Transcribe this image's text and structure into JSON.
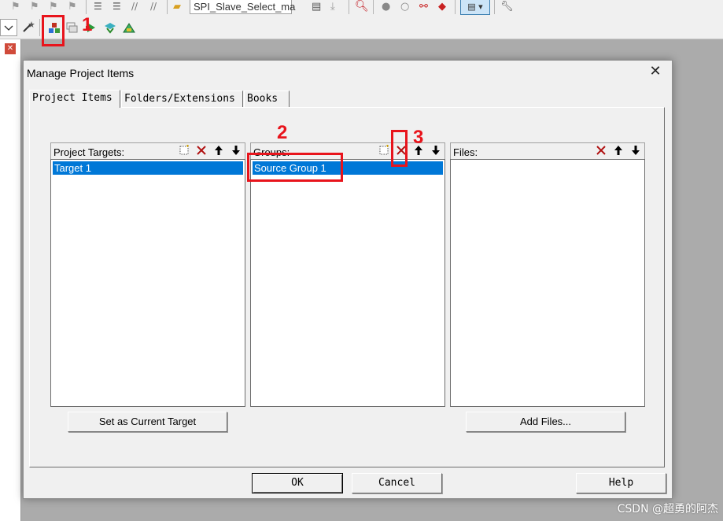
{
  "toolbar": {
    "target_select": "SPI_Slave_Select_ma",
    "icons": [
      "flag-icon",
      "flag-icon",
      "flag-icon",
      "flag-icon",
      "indent-icon",
      "outdent-icon",
      "comment-icon",
      "uncomment-icon",
      "open-folder-icon",
      "load-icon",
      "download-icon",
      "find-icon",
      "circle-icon",
      "circle-outline-icon",
      "link-icon",
      "fire-icon",
      "window-icon",
      "wrench-icon",
      "combo-arrow-icon",
      "magic-wand-icon",
      "manage-project-items-icon",
      "stack-icon",
      "translate-icon",
      "build-icon",
      "rebuild-icon"
    ]
  },
  "annotations": {
    "one": "1",
    "two": "2",
    "three": "3"
  },
  "dialog": {
    "title": "Manage Project Items",
    "close_glyph": "✕",
    "tabs": [
      {
        "label": "Project Items",
        "active": true
      },
      {
        "label": "Folders/Extensions",
        "active": false
      },
      {
        "label": "Books",
        "active": false
      }
    ],
    "targets": {
      "header": "Project Targets:",
      "items": [
        "Target 1"
      ]
    },
    "groups": {
      "header": "Groups:",
      "items": [
        "Source Group 1"
      ]
    },
    "files": {
      "header": "Files:",
      "items": []
    },
    "buttons": {
      "set_current": "Set as Current Target",
      "add_files": "Add Files...",
      "ok": "OK",
      "cancel": "Cancel",
      "help": "Help"
    }
  },
  "watermark": "CSDN @超勇的阿杰",
  "colors": {
    "selection": "#0078d7",
    "annotation": "#e8141c",
    "delete_red": "#b01010"
  }
}
